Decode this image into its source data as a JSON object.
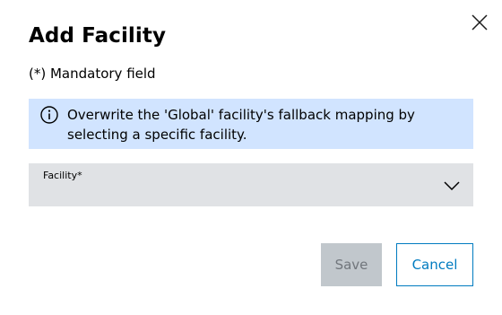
{
  "dialog": {
    "title": "Add Facility",
    "mandatory_note": "(*) Mandatory field",
    "close_icon": "close-icon"
  },
  "info": {
    "icon": "info-icon",
    "message": "Overwrite the 'Global' facility's fallback mapping by selecting a specific facility.",
    "background_color": "#d1e4ff"
  },
  "facility_select": {
    "label": "Facility*",
    "value": "",
    "icon": "chevron-down-icon"
  },
  "actions": {
    "save_label": "Save",
    "save_disabled": true,
    "cancel_label": "Cancel",
    "accent_color": "#007bc0"
  }
}
